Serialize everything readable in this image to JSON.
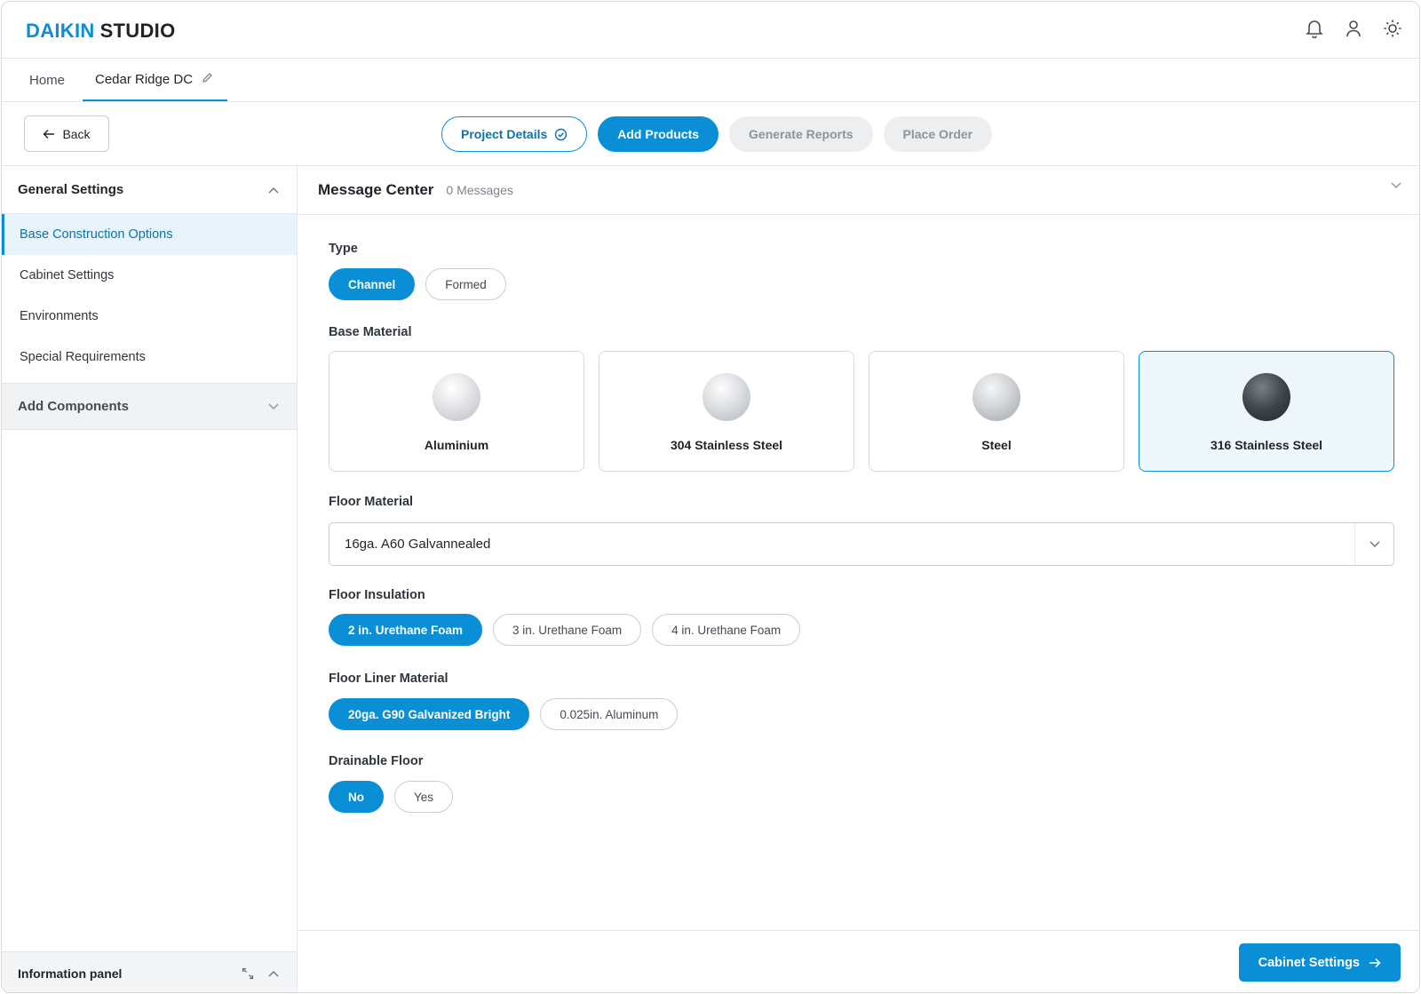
{
  "brand": {
    "part1": "DAIKIN",
    "part2": "STUDIO",
    "accent_color": "#0a8fd6"
  },
  "header_icons": [
    "bell-icon",
    "user-icon",
    "sun-icon"
  ],
  "tabs": [
    {
      "label": "Home"
    },
    {
      "label": "Cedar Ridge DC",
      "icon": "pencil-icon"
    }
  ],
  "back_label": "Back",
  "steps": [
    {
      "label": "Project Details",
      "state": "done"
    },
    {
      "label": "Add Products",
      "state": "current"
    },
    {
      "label": "Generate Reports",
      "state": "disabled"
    },
    {
      "label": "Place Order",
      "state": "disabled"
    }
  ],
  "sidebar": {
    "section_title": "General Settings",
    "items": [
      {
        "label": "Base Construction Options",
        "active": true
      },
      {
        "label": "Cabinet Settings"
      },
      {
        "label": "Environments"
      },
      {
        "label": "Special Requirements"
      }
    ],
    "collapsed_section": "Add Components",
    "info_panel": "Information panel"
  },
  "message_center": {
    "title": "Message Center",
    "count": "0 Messages"
  },
  "form": {
    "type": {
      "label": "Type",
      "options": [
        "Channel",
        "Formed"
      ],
      "selected": "Channel"
    },
    "base_material": {
      "label": "Base Material",
      "options": [
        "Aluminium",
        "304 Stainless Steel",
        "Steel",
        "316 Stainless Steel"
      ],
      "selected": "316 Stainless Steel"
    },
    "floor_material": {
      "label": "Floor Material",
      "value": "16ga. A60 Galvannealed"
    },
    "floor_insulation": {
      "label": "Floor Insulation",
      "options": [
        "2 in. Urethane Foam",
        "3 in. Urethane Foam",
        "4 in. Urethane Foam"
      ],
      "selected": "2 in. Urethane Foam"
    },
    "floor_liner": {
      "label": "Floor Liner Material",
      "options": [
        "20ga. G90 Galvanized Bright",
        "0.025in. Aluminum"
      ],
      "selected": "20ga. G90 Galvanized Bright"
    },
    "drainable_floor": {
      "label": "Drainable Floor",
      "options": [
        "No",
        "Yes"
      ],
      "selected": "No"
    }
  },
  "footer": {
    "next_label": "Cabinet Settings"
  }
}
